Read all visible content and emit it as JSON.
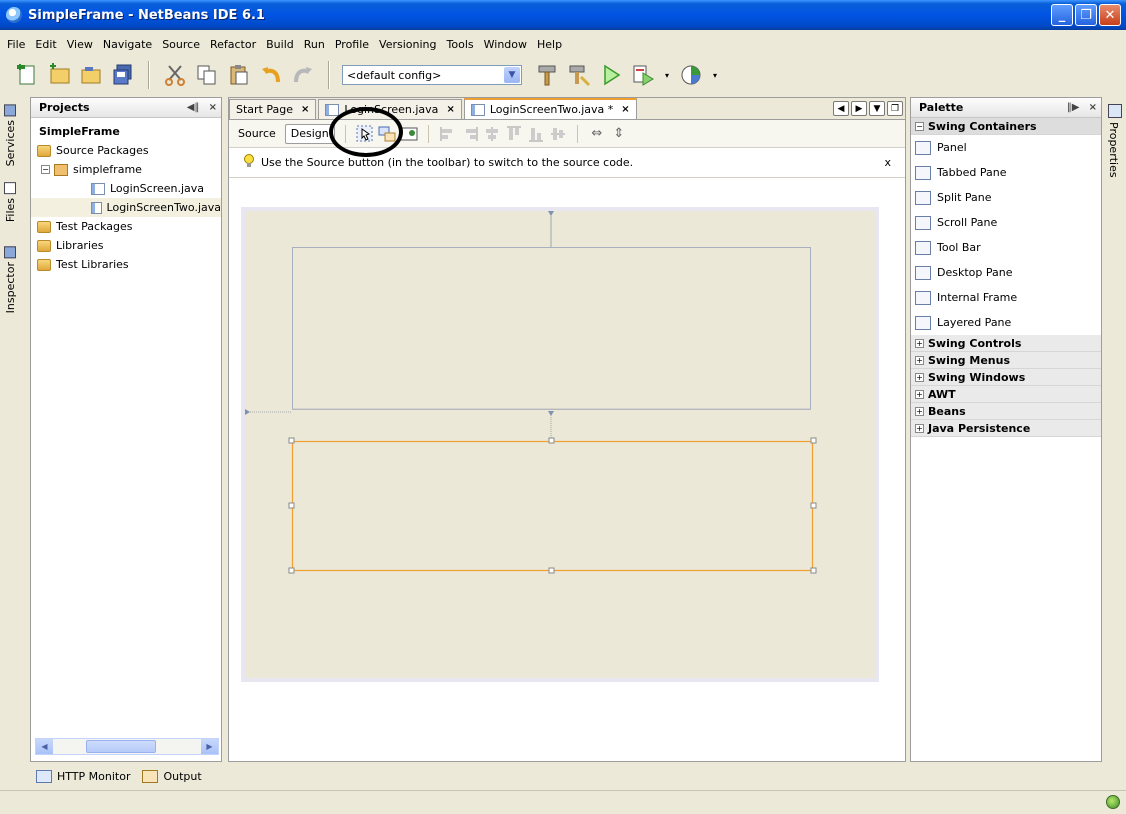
{
  "window": {
    "title": "SimpleFrame - NetBeans IDE 6.1"
  },
  "menu": [
    "File",
    "Edit",
    "View",
    "Navigate",
    "Source",
    "Refactor",
    "Build",
    "Run",
    "Profile",
    "Versioning",
    "Tools",
    "Window",
    "Help"
  ],
  "toolbar": {
    "config_value": "<default config>"
  },
  "side_tabs": {
    "services": "Services",
    "files": "Files",
    "inspector": "Inspector",
    "properties": "Properties"
  },
  "projects": {
    "title": "Projects",
    "tree": [
      {
        "label": "SimpleFrame",
        "icon": "project"
      },
      {
        "label": "Source Packages",
        "icon": "folder"
      },
      {
        "label": "simpleframe",
        "icon": "package"
      },
      {
        "label": "LoginScreen.java",
        "icon": "java-form"
      },
      {
        "label": "LoginScreenTwo.java",
        "icon": "java-form"
      },
      {
        "label": "Test Packages",
        "icon": "folder"
      },
      {
        "label": "Libraries",
        "icon": "folder"
      },
      {
        "label": "Test Libraries",
        "icon": "folder"
      }
    ]
  },
  "editor": {
    "tabs": [
      {
        "label": "Start Page"
      },
      {
        "label": "LoginScreen.java"
      },
      {
        "label": "LoginScreenTwo.java *"
      }
    ],
    "modes": {
      "source": "Source",
      "design": "Design"
    },
    "hint": "Use the Source button (in the toolbar) to switch to the source code.",
    "hint_close": "x"
  },
  "palette": {
    "title": "Palette",
    "open_category": "Swing Containers",
    "items": [
      "Panel",
      "Tabbed Pane",
      "Split Pane",
      "Scroll Pane",
      "Tool Bar",
      "Desktop Pane",
      "Internal Frame",
      "Layered Pane"
    ],
    "categories": [
      "Swing Controls",
      "Swing Menus",
      "Swing Windows",
      "AWT",
      "Beans",
      "Java Persistence"
    ]
  },
  "bottom": {
    "http_monitor": "HTTP Monitor",
    "output": "Output"
  },
  "colors": {
    "selection_border": "#f0a030",
    "canvas_bg": "#ebe8d8",
    "titlebar": "#0054e3"
  }
}
